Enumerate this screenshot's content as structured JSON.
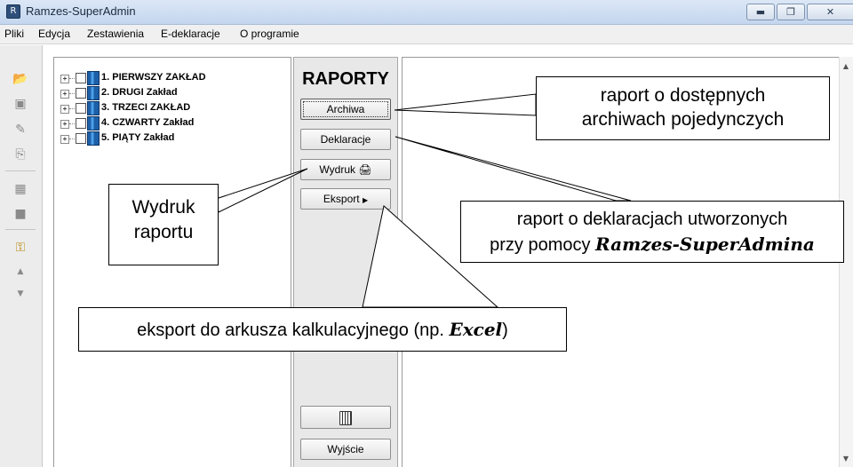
{
  "window": {
    "title": "Ramzes-SuperAdmin",
    "controls": {
      "minimize": "▬",
      "maximize": "❐",
      "close": "✕"
    }
  },
  "menu": {
    "items": [
      {
        "label": "Pliki"
      },
      {
        "label": "Edycja"
      },
      {
        "label": "Zestawienia"
      },
      {
        "label": "E-deklaracje"
      },
      {
        "label": "O programie"
      }
    ]
  },
  "toolbar": {
    "icons": [
      "folder-open-icon",
      "save-icon",
      "pencil-icon",
      "copy-icon",
      "calendar-icon",
      "stop-icon",
      "key-icon",
      "arrow-up-icon",
      "arrow-down-icon"
    ]
  },
  "tree": {
    "items": [
      {
        "label": "1. PIERWSZY ZAKŁAD"
      },
      {
        "label": "2. DRUGI Zakład"
      },
      {
        "label": "3. TRZECI ZAKŁAD"
      },
      {
        "label": "4. CZWARTY Zakład"
      },
      {
        "label": "5. PIĄTY Zakład"
      }
    ]
  },
  "reports": {
    "title": "RAPORTY",
    "archiwa": "Archiwa",
    "deklaracje": "Deklaracje",
    "wydruk": "Wydruk",
    "eksport": "Eksport",
    "wyjscie": "Wyjście"
  },
  "callouts": {
    "archiwa": {
      "line1": "raport o dostępnych",
      "line2": "archiwach pojedynczych"
    },
    "deklaracje": {
      "line1": "raport o deklaracjach utworzonych",
      "line2_prefix": "przy pomocy ",
      "line2_emph": "Ramzes-SuperAdmina"
    },
    "wydruk": {
      "line1": "Wydruk",
      "line2": "raportu"
    },
    "eksport": {
      "prefix": "eksport do arkusza kalkulacyjnego (np. ",
      "emph": "Excel",
      "suffix": ")"
    }
  }
}
